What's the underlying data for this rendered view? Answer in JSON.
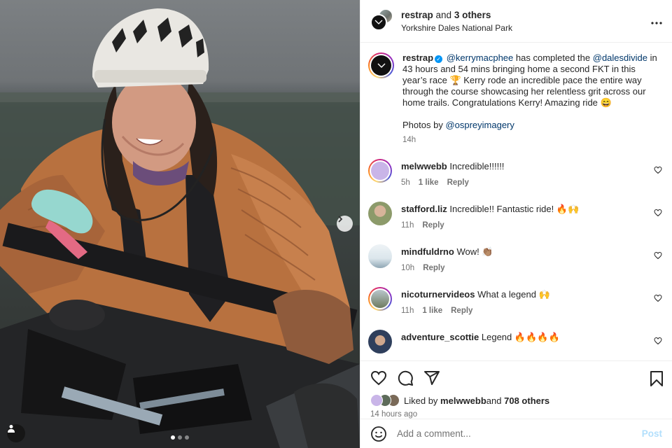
{
  "header": {
    "account": "restrap",
    "others_prefix": " and ",
    "others": "3 others",
    "location": "Yorkshire Dales National Park"
  },
  "caption": {
    "username": "restrap",
    "mention1": "@kerrymacphee",
    "text1": " has completed the ",
    "mention2": "@dalesdivide",
    "text2": " in 43 hours and 54 mins bringing home a second FKT in this year’s race 🏆 Kerry rode an incredible pace the entire way through the course showcasing her relentless grit across our home trails. Congratulations Kerry! Amazing ride 😄",
    "photos_prefix": "Photos by ",
    "photos_mention": "@ospreyimagery",
    "time": "14h"
  },
  "comments": [
    {
      "user": "melwwebb",
      "text": "Incredible!!!!!!",
      "time": "5h",
      "likes": "1 like",
      "reply": "Reply"
    },
    {
      "user": "stafford.liz",
      "text": "Incredible!! Fantastic ride! 🔥🙌",
      "time": "11h",
      "likes": "",
      "reply": "Reply"
    },
    {
      "user": "mindfuldrno",
      "text": "Wow! 👏🏽",
      "time": "10h",
      "likes": "",
      "reply": "Reply"
    },
    {
      "user": "nicoturnervideos",
      "text": "What a legend 🙌",
      "time": "11h",
      "likes": "1 like",
      "reply": "Reply"
    },
    {
      "user": "adventure_scottie",
      "text": "Legend 🔥🔥🔥🔥",
      "time": "",
      "likes": "",
      "reply": ""
    }
  ],
  "likes": {
    "prefix": "Liked by ",
    "user": "melwwebb",
    "middle": " and ",
    "others": "708 others"
  },
  "post_time": "14 hours ago",
  "comment_box": {
    "placeholder": "Add a comment...",
    "post_label": "Post"
  },
  "carousel": {
    "count": 3,
    "active": 0
  },
  "colors": {
    "link": "#00376b",
    "verified": "#0095f6",
    "post_disabled": "#b2dffc"
  },
  "icons": [
    "heart-icon",
    "comment-icon",
    "share-icon",
    "bookmark-icon",
    "emoji-icon",
    "more-icon",
    "chevron-right-icon",
    "user-tag-icon",
    "verified-badge-icon"
  ]
}
